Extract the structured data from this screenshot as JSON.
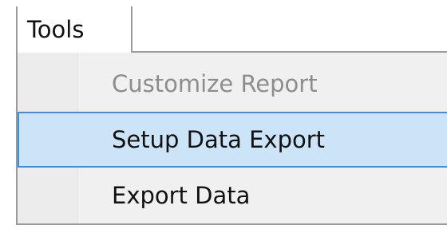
{
  "menu": {
    "title": "Tools",
    "items": [
      {
        "label": "Customize Report",
        "enabled": false,
        "highlighted": false
      },
      {
        "label": "Setup Data Export",
        "enabled": true,
        "highlighted": true
      },
      {
        "label": "Export Data",
        "enabled": true,
        "highlighted": false
      }
    ]
  },
  "colors": {
    "highlight_fill": "#cce4f7",
    "highlight_border": "#3d8ee0",
    "disabled_text": "#8d8d8d",
    "menu_background": "#f0f0f0",
    "border": "#9b9b9b"
  }
}
